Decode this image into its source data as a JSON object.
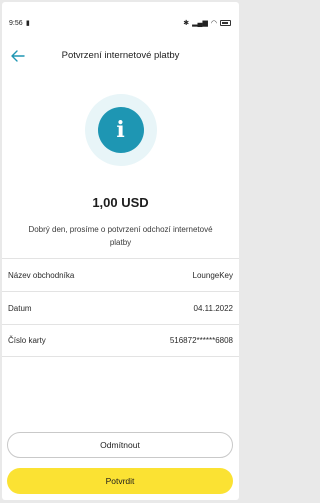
{
  "status_bar": {
    "time": "9:56",
    "notification_icon": "notification-icon",
    "icons": [
      "bluetooth-icon",
      "signal-icon",
      "signal-icon",
      "wifi-icon",
      "battery-icon"
    ]
  },
  "app_bar": {
    "title": "Potvrzení internetové platby",
    "back_icon": "arrow-left-icon"
  },
  "info": {
    "icon_glyph": "i",
    "icon_name": "info-icon"
  },
  "amount": "1,00 USD",
  "message": "Dobrý den, prosíme o potvrzení odchozí internetové platby",
  "details": [
    {
      "label": "Název obchodníka",
      "value": "LoungeKey"
    },
    {
      "label": "Datum",
      "value": "04.11.2022"
    },
    {
      "label": "Číslo karty",
      "value": "516872******6808"
    }
  ],
  "buttons": {
    "reject": "Odmítnout",
    "confirm": "Potvrdit"
  },
  "colors": {
    "accent_yellow": "#fbe233",
    "info_blue": "#1e96b3",
    "back_arrow": "#1e96b3"
  }
}
